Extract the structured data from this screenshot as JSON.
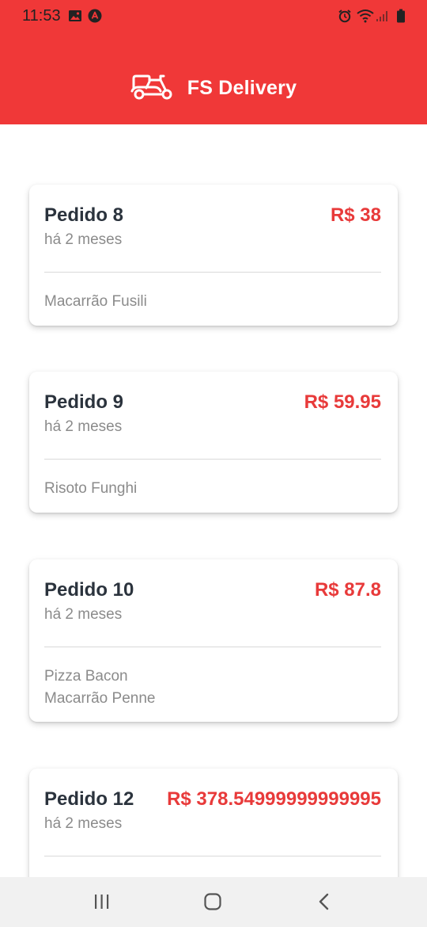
{
  "status_bar": {
    "time": "11:53"
  },
  "header": {
    "title": "FS Delivery",
    "logo_icon": "scooter-icon",
    "background_color": "#F03838"
  },
  "orders": [
    {
      "title": "Pedido 8",
      "price": "R$ 38",
      "time": "há 2 meses",
      "items": [
        "Macarrão Fusili"
      ]
    },
    {
      "title": "Pedido 9",
      "price": "R$ 59.95",
      "time": "há 2 meses",
      "items": [
        "Risoto Funghi"
      ]
    },
    {
      "title": "Pedido 10",
      "price": "R$ 87.8",
      "time": "há 2 meses",
      "items": [
        "Pizza Bacon",
        "Macarrão Penne"
      ]
    },
    {
      "title": "Pedido 12",
      "price": "R$ 378.54999999999995",
      "time": "há 2 meses",
      "items": []
    }
  ],
  "colors": {
    "accent": "#E83A3A",
    "title_text": "#2b333d",
    "muted_text": "#8b8b8b"
  },
  "nav": {
    "recents_icon": "recents-icon",
    "home_icon": "home-icon",
    "back_icon": "back-icon"
  }
}
